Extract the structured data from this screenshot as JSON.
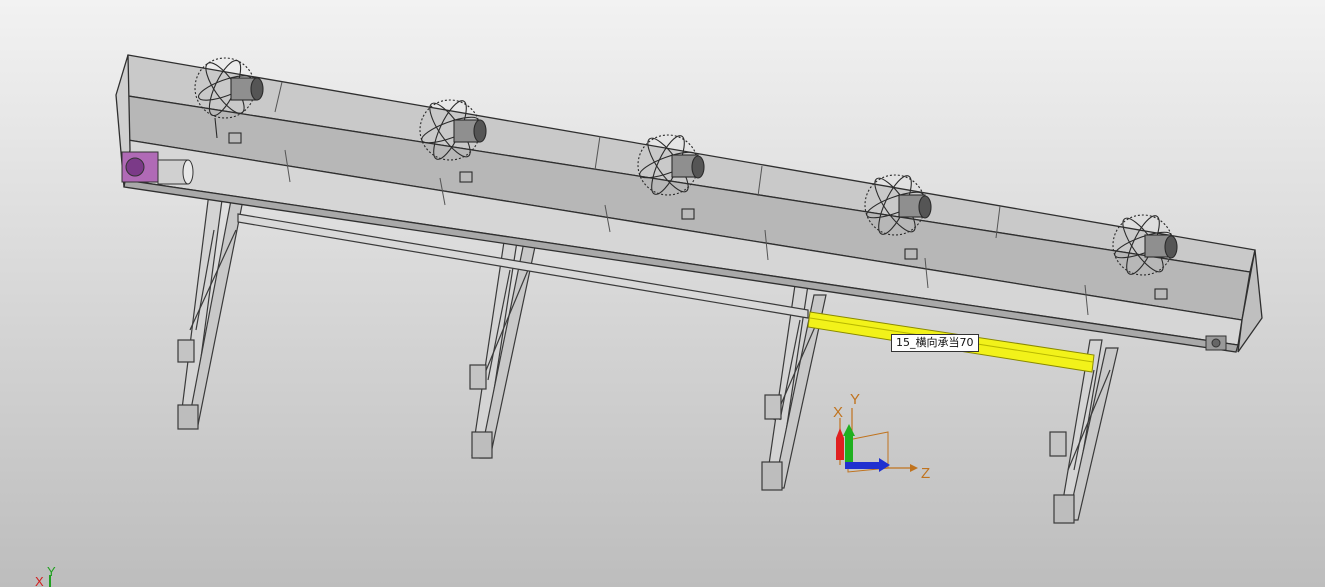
{
  "viewport": {
    "selected_part_tooltip": "15_横向承当70",
    "triad": {
      "x_label": "X",
      "y_label": "Y",
      "z_label": "Z"
    },
    "mini_triad": {
      "x_label": "X",
      "y_label": "Y"
    },
    "highlight_color": "#f2f21a",
    "background_top": "#f2f2f2",
    "background_bottom": "#bdbdbd"
  }
}
